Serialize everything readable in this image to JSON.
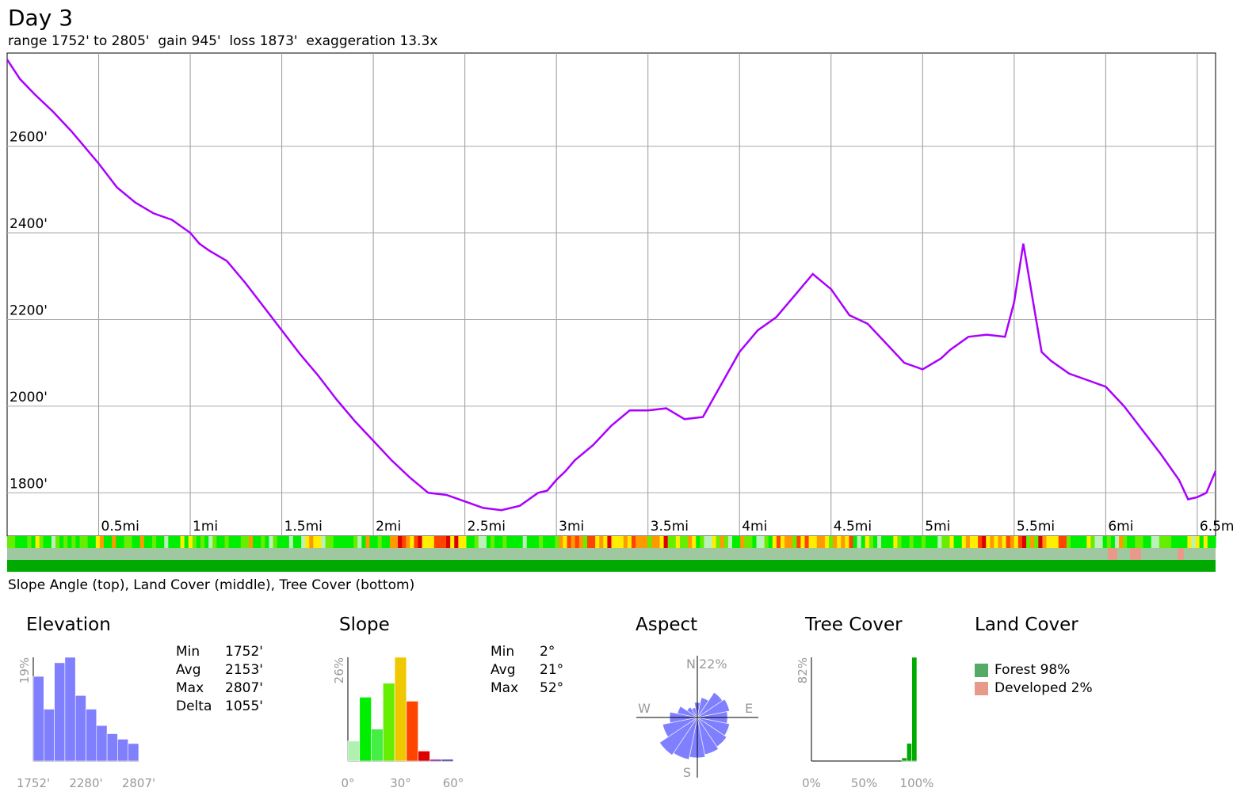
{
  "title": "Day 3",
  "subtitle": "range 1752' to 2805'  gain 945'  loss 1873'  exaggeration 13.3x",
  "bands_caption": "Slope Angle (top), Land Cover (middle), Tree Cover (bottom)",
  "chart_data": [
    {
      "type": "line",
      "name": "elevation-profile",
      "xlim": [
        0,
        6.6
      ],
      "ylim": [
        1700,
        2815
      ],
      "x_ticks": [
        0.5,
        1,
        1.5,
        2,
        2.5,
        3,
        3.5,
        4,
        4.5,
        5,
        5.5,
        6,
        6.5
      ],
      "x_tick_labels": [
        "0.5mi",
        "1mi",
        "1.5mi",
        "2mi",
        "2.5mi",
        "3mi",
        "3.5mi",
        "4mi",
        "4.5mi",
        "5mi",
        "5.5mi",
        "6mi",
        "6.5mi"
      ],
      "y_ticks": [
        1800,
        2000,
        2200,
        2400,
        2600
      ],
      "y_tick_labels": [
        "1800'",
        "2000'",
        "2200'",
        "2400'",
        "2600'"
      ],
      "grid": true,
      "line_color": "#aa00ff",
      "x": [
        0,
        0.07,
        0.15,
        0.25,
        0.35,
        0.45,
        0.5,
        0.6,
        0.7,
        0.8,
        0.9,
        1.0,
        1.05,
        1.1,
        1.2,
        1.3,
        1.4,
        1.5,
        1.6,
        1.7,
        1.8,
        1.9,
        2.0,
        2.1,
        2.2,
        2.3,
        2.4,
        2.5,
        2.6,
        2.7,
        2.8,
        2.9,
        2.95,
        3.0,
        3.05,
        3.1,
        3.2,
        3.3,
        3.4,
        3.5,
        3.6,
        3.7,
        3.8,
        3.9,
        4.0,
        4.1,
        4.2,
        4.3,
        4.4,
        4.5,
        4.6,
        4.7,
        4.8,
        4.9,
        5.0,
        5.1,
        5.15,
        5.25,
        5.35,
        5.45,
        5.5,
        5.55,
        5.6,
        5.65,
        5.7,
        5.8,
        5.9,
        6.0,
        6.1,
        6.2,
        6.3,
        6.4,
        6.45,
        6.5,
        6.55,
        6.6
      ],
      "y": [
        2800,
        2755,
        2720,
        2680,
        2635,
        2585,
        2560,
        2505,
        2470,
        2445,
        2430,
        2400,
        2375,
        2360,
        2335,
        2285,
        2230,
        2175,
        2120,
        2070,
        2015,
        1965,
        1920,
        1875,
        1835,
        1800,
        1795,
        1780,
        1765,
        1760,
        1770,
        1800,
        1805,
        1830,
        1850,
        1875,
        1910,
        1955,
        1990,
        1990,
        1995,
        1970,
        1975,
        2050,
        2125,
        2175,
        2205,
        2255,
        2305,
        2270,
        2210,
        2190,
        2145,
        2100,
        2085,
        2110,
        2130,
        2160,
        2165,
        2160,
        2240,
        2375,
        2250,
        2125,
        2105,
        2075,
        2060,
        2045,
        2000,
        1945,
        1890,
        1830,
        1785,
        1790,
        1800,
        1850
      ]
    },
    {
      "type": "bar",
      "name": "elevation-histogram",
      "title": "Elevation",
      "values": [
        15.5,
        9.5,
        18,
        19,
        12,
        9.5,
        6.5,
        5,
        4,
        3.2
      ],
      "ylim": [
        0,
        19
      ],
      "bar_color": "#8080ff",
      "y_tick_labels": [
        "19%"
      ],
      "x_tick_labels": [
        "1752'",
        "2280'",
        "2807'"
      ]
    },
    {
      "type": "bar",
      "name": "slope-histogram",
      "title": "Slope",
      "values": [
        5,
        16,
        8,
        19.5,
        26,
        15,
        2.5,
        0.4,
        0.4
      ],
      "colors": [
        "#b0f0b0",
        "#00ee00",
        "#44ee44",
        "#66ee00",
        "#f0c800",
        "#ff4400",
        "#dd0000",
        "#8000a0",
        "#2020aa"
      ],
      "ylim": [
        0,
        26
      ],
      "y_tick_labels": [
        "26%"
      ],
      "x_tick_labels": [
        "0°",
        "30°",
        "60°"
      ]
    },
    {
      "type": "pie",
      "name": "aspect-rose",
      "title": "Aspect",
      "directions": [
        "N",
        "NNE",
        "NE",
        "ENE",
        "E",
        "ESE",
        "SE",
        "SSE",
        "S",
        "SSW",
        "SW",
        "WSW",
        "W",
        "WNW",
        "NW",
        "NNW"
      ],
      "values": [
        6,
        8,
        12,
        13,
        12,
        13,
        14,
        15,
        16,
        17,
        18,
        14,
        11,
        8,
        5,
        4
      ],
      "max_percent": 22,
      "color": "#8080ff",
      "labels": {
        "N": "N",
        "E": "E",
        "S": "S",
        "W": "W",
        "max": "22%"
      }
    },
    {
      "type": "bar",
      "name": "tree-cover-histogram",
      "title": "Tree Cover",
      "values": [
        0,
        0,
        0,
        0,
        0,
        0,
        0,
        0,
        0,
        0,
        0,
        0,
        0,
        0,
        0,
        0,
        0,
        0,
        2.5,
        14,
        82
      ],
      "color": "#00aa00",
      "ylim": [
        0,
        82
      ],
      "y_tick_labels": [
        "82%"
      ],
      "x_tick_labels": [
        "0%",
        "50%",
        "100%"
      ]
    }
  ],
  "elevation_stats": [
    {
      "label": "Min",
      "value": "1752'"
    },
    {
      "label": "Avg",
      "value": "2153'"
    },
    {
      "label": "Max",
      "value": "2807'"
    },
    {
      "label": "Delta",
      "value": "1055'"
    }
  ],
  "slope_stats": [
    {
      "label": "Min",
      "value": "2°"
    },
    {
      "label": "Avg",
      "value": "21°"
    },
    {
      "label": "Max",
      "value": "52°"
    }
  ],
  "land_cover": {
    "title": "Land Cover",
    "items": [
      {
        "label": "Forest 98%",
        "color": "#55aa66"
      },
      {
        "label": "Developed 2%",
        "color": "#e89a8a"
      }
    ]
  },
  "slope_band_colors": [
    "#00ee00",
    "#66ee00",
    "#bbf0bb",
    "#ffee00",
    "#ff9900",
    "#ff4400",
    "#dd0000"
  ],
  "land_band_color": "#a0c8a0",
  "tree_band_color": "#00aa00"
}
